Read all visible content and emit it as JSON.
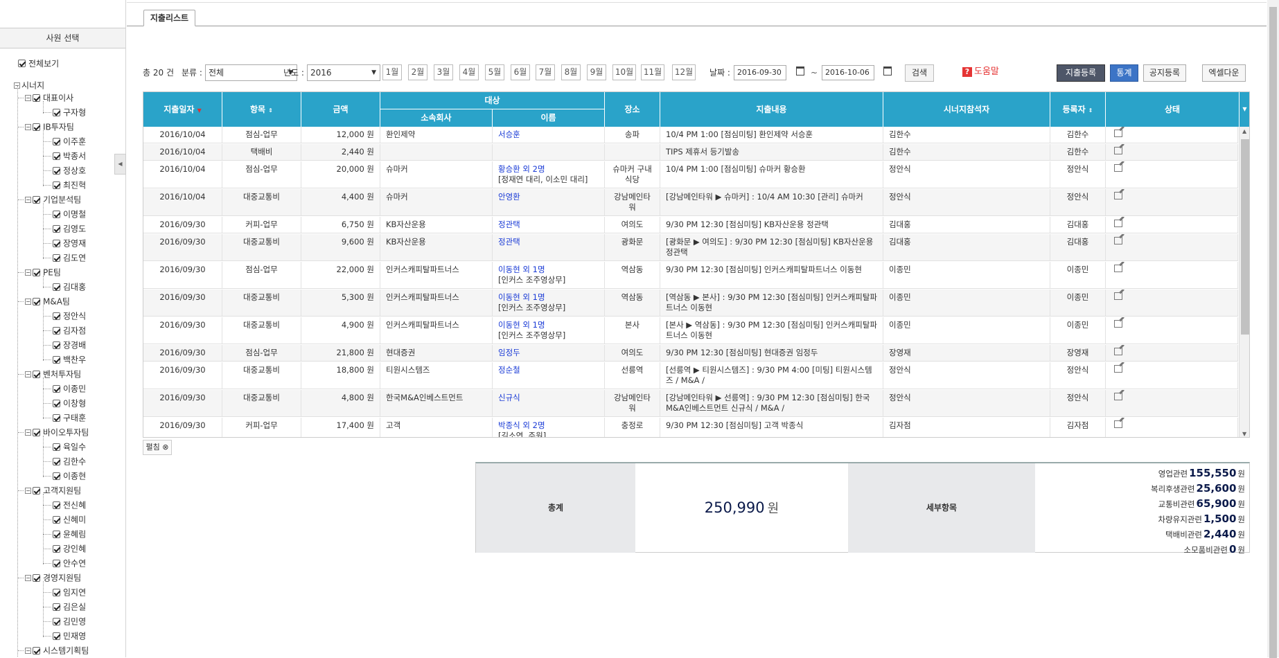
{
  "sidebar": {
    "title": "사원 선택",
    "all_view": "전체보기",
    "root": "시너지",
    "teams": [
      {
        "name": "대표이사",
        "members": [
          "구자형"
        ]
      },
      {
        "name": "IB투자팀",
        "members": [
          "이주훈",
          "박종서",
          "정상호",
          "최진혁"
        ]
      },
      {
        "name": "기업분석팀",
        "members": [
          "이명철",
          "김영도",
          "장영재",
          "김도연"
        ]
      },
      {
        "name": "PE팀",
        "members": [
          "김대홍"
        ]
      },
      {
        "name": "M&A팀",
        "members": [
          "정안식",
          "김자점",
          "장경배",
          "백찬우"
        ]
      },
      {
        "name": "벤처투자팀",
        "members": [
          "이종민",
          "이창형",
          "구태훈"
        ]
      },
      {
        "name": "바이오투자팀",
        "members": [
          "육일수",
          "김한수",
          "이종현"
        ]
      },
      {
        "name": "고객지원팀",
        "members": [
          "전신혜",
          "신혜미",
          "윤혜림",
          "강인혜",
          "안수연"
        ]
      },
      {
        "name": "경영지원팀",
        "members": [
          "임지연",
          "김은실",
          "김민영",
          "민재영"
        ]
      },
      {
        "name": "시스템기획팀",
        "members": []
      }
    ]
  },
  "tab": {
    "label": "지출리스트"
  },
  "filters": {
    "total_count": "총 20 건",
    "category_label": "분류 :",
    "category_value": "전체",
    "year_label": "년도 :",
    "year_value": "2016",
    "months": [
      "1월",
      "2월",
      "3월",
      "4월",
      "5월",
      "6월",
      "7월",
      "8월",
      "9월",
      "10월",
      "11월",
      "12월"
    ],
    "date_label": "날짜 :",
    "date_from": "2016-09-30",
    "tilde": "~",
    "date_to": "2016-10-06",
    "search": "검색",
    "help": "도움말",
    "help_mark": "?",
    "register": "지출등록",
    "stats": "통계",
    "notice": "공지등록",
    "excel": "엑셀다운"
  },
  "grid": {
    "headers": {
      "date": "지출일자",
      "item": "항목",
      "amount": "금액",
      "target": "대상",
      "company": "소속회사",
      "name": "이름",
      "place": "장소",
      "content": "지출내용",
      "attendee": "시너지참석자",
      "registrant": "등록자",
      "status": "상태"
    },
    "rows": [
      {
        "date": "2016/10/04",
        "item": "점심-업무",
        "amount": "12,000 원",
        "company": "환인제약",
        "name": "서승훈",
        "name2": "",
        "place": "송파",
        "content": "10/4 PM 1:00 [점심미팅] 환인제약 서승훈",
        "attendee": "김한수",
        "registrant": "김한수"
      },
      {
        "date": "2016/10/04",
        "item": "택배비",
        "amount": "2,440 원",
        "company": "",
        "name": "",
        "name2": "",
        "place": "",
        "content": "TIPS 제휴서 등기발송",
        "attendee": "김한수",
        "registrant": "김한수"
      },
      {
        "date": "2016/10/04",
        "item": "점심-업무",
        "amount": "20,000 원",
        "company": "슈마커",
        "name": "황승환 외 2명",
        "name2": "[정재연 대리, 이소민 대리]",
        "place": "슈마커 구내식당",
        "content": "10/4 PM 1:00 [점심미팅] 슈마커 황승환",
        "attendee": "정안식",
        "registrant": "정안식"
      },
      {
        "date": "2016/10/04",
        "item": "대중교통비",
        "amount": "4,400 원",
        "company": "슈마커",
        "name": "안영환",
        "name2": "",
        "place": "강남메인타워",
        "content": "[강남메인타워 ▶ 슈마커] : 10/4 AM 10:30 [관리] 슈마커",
        "attendee": "정안식",
        "registrant": "정안식"
      },
      {
        "date": "2016/09/30",
        "item": "커피-업무",
        "amount": "6,750 원",
        "company": "KB자산운용",
        "name": "정관택",
        "name2": "",
        "place": "여의도",
        "content": "9/30 PM 12:30 [점심미팅] KB자산운용 정관택",
        "attendee": "김대홍",
        "registrant": "김대홍"
      },
      {
        "date": "2016/09/30",
        "item": "대중교통비",
        "amount": "9,600 원",
        "company": "KB자산운용",
        "name": "정관택",
        "name2": "",
        "place": "광화문",
        "content": "[광화문 ▶ 여의도] : 9/30 PM 12:30 [점심미팅] KB자산운용 정관택",
        "attendee": "김대홍",
        "registrant": "김대홍"
      },
      {
        "date": "2016/09/30",
        "item": "점심-업무",
        "amount": "22,000 원",
        "company": "인커스캐피탈파트너스",
        "name": "이동현 외 1명",
        "name2": "[인커스 조주영상무]",
        "place": "역삼동",
        "content": "9/30 PM 12:30 [점심미팅] 인커스캐피탈파트너스 이동현",
        "attendee": "이종민",
        "registrant": "이종민"
      },
      {
        "date": "2016/09/30",
        "item": "대중교통비",
        "amount": "5,300 원",
        "company": "인커스캐피탈파트너스",
        "name": "이동현 외 1명",
        "name2": "[인커스 조주영상무]",
        "place": "역삼동",
        "content": "[역삼동 ▶ 본사] : 9/30 PM 12:30 [점심미팅] 인커스캐피탈파트너스 이동현",
        "attendee": "이종민",
        "registrant": "이종민"
      },
      {
        "date": "2016/09/30",
        "item": "대중교통비",
        "amount": "4,900 원",
        "company": "인커스캐피탈파트너스",
        "name": "이동현 외 1명",
        "name2": "[인커스 조주영상무]",
        "place": "본사",
        "content": "[본사 ▶ 역삼동] : 9/30 PM 12:30 [점심미팅] 인커스캐피탈파트너스 이동현",
        "attendee": "이종민",
        "registrant": "이종민"
      },
      {
        "date": "2016/09/30",
        "item": "점심-업무",
        "amount": "21,800 원",
        "company": "현대증권",
        "name": "임정두",
        "name2": "",
        "place": "여의도",
        "content": "9/30 PM 12:30 [점심미팅] 현대증권 임정두",
        "attendee": "장영재",
        "registrant": "장영재"
      },
      {
        "date": "2016/09/30",
        "item": "대중교통비",
        "amount": "18,800 원",
        "company": "티원시스템즈",
        "name": "정순철",
        "name2": "",
        "place": "선릉역",
        "content": "[선릉역 ▶ 티원시스템즈] : 9/30 PM 4:00 [미팅] 티원시스템즈 / M&A /",
        "attendee": "정안식",
        "registrant": "정안식"
      },
      {
        "date": "2016/09/30",
        "item": "대중교통비",
        "amount": "4,800 원",
        "company": "한국M&A인베스트먼트",
        "name": "신규식",
        "name2": "",
        "place": "강남메인타워",
        "content": "[강남메인타워 ▶ 선릉역] : 9/30 PM 12:30 [점심미팅] 한국M&A인베스트먼트 신규식 / M&A /",
        "attendee": "정안식",
        "registrant": "정안식"
      },
      {
        "date": "2016/09/30",
        "item": "커피-업무",
        "amount": "17,400 원",
        "company": "고객",
        "name": "박종식 외 2명",
        "name2": "[길소연, 주원]",
        "place": "충정로",
        "content": "9/30 PM 12:30 [점심미팅] 고객 박종식",
        "attendee": "김자점",
        "registrant": "김자점"
      }
    ]
  },
  "fold": "펼침",
  "fold_icon": "⊗",
  "summary": {
    "total_label": "총계",
    "total_value": "250,990",
    "total_unit": "원",
    "detail_label": "세부항목",
    "details": [
      {
        "label": "영업관련",
        "value": "155,550",
        "unit": "원"
      },
      {
        "label": "복리후생관련",
        "value": "25,600",
        "unit": "원"
      },
      {
        "label": "교통비관련",
        "value": "65,900",
        "unit": "원"
      },
      {
        "label": "차량유지관련",
        "value": "1,500",
        "unit": "원"
      },
      {
        "label": "택배비관련",
        "value": "2,440",
        "unit": "원"
      },
      {
        "label": "소모품비관련",
        "value": "0",
        "unit": "원"
      }
    ]
  }
}
